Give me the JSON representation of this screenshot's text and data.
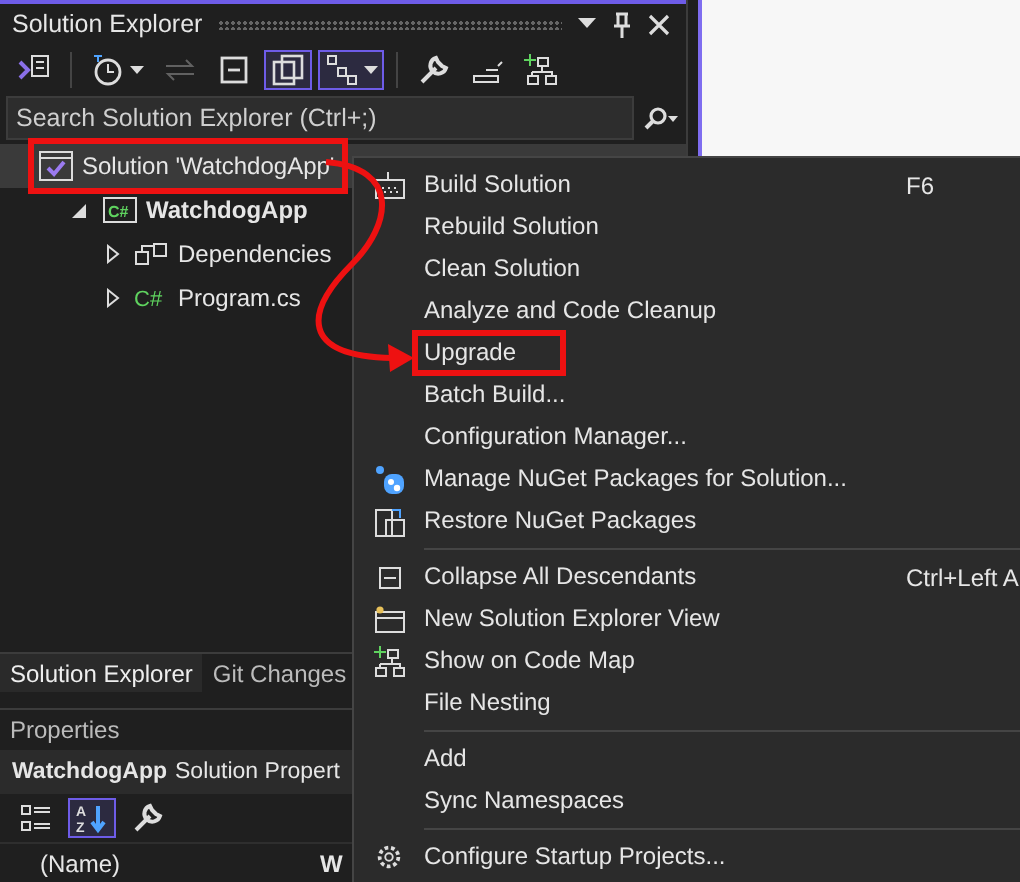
{
  "panel": {
    "title": "Solution Explorer"
  },
  "toolbar": [
    {
      "kind": "home",
      "selected": false,
      "disabled": false
    },
    {
      "kind": "history",
      "selected": false,
      "disabled": false
    },
    {
      "kind": "sync",
      "selected": false,
      "disabled": true
    },
    {
      "kind": "collapse",
      "selected": false,
      "disabled": false
    },
    {
      "kind": "show-all",
      "selected": true,
      "disabled": false
    },
    {
      "kind": "view",
      "selected": true,
      "disabled": false
    },
    {
      "kind": "properties",
      "selected": false,
      "disabled": false
    },
    {
      "kind": "preview",
      "selected": false,
      "disabled": false
    },
    {
      "kind": "code-map",
      "selected": false,
      "disabled": false
    }
  ],
  "search": {
    "placeholder": "Search Solution Explorer (Ctrl+;)"
  },
  "tree": [
    {
      "label": "Solution 'WatchdogApp'",
      "kind": "solution",
      "selected": true,
      "highlighted": true,
      "children": [
        {
          "label": "WatchdogApp",
          "kind": "project",
          "badge": "C#",
          "selected": false,
          "highlighted": false,
          "expanded": true,
          "children": [
            {
              "label": "Dependencies",
              "kind": "dependencies",
              "selected": false,
              "highlighted": false,
              "expanded": false
            },
            {
              "label": "Program.cs",
              "kind": "csharp",
              "badge": "C#",
              "selected": false,
              "highlighted": false,
              "expanded": false
            }
          ]
        }
      ]
    }
  ],
  "bottom_tabs": [
    {
      "label": "Solution Explorer",
      "selected": true
    },
    {
      "label": "Git Changes",
      "selected": false
    }
  ],
  "properties": {
    "title": "Properties",
    "object": "WatchdogApp",
    "object_type": "Solution Propert",
    "toolbar": [
      {
        "kind": "categorized",
        "selected": false
      },
      {
        "kind": "alphabetical",
        "glyphs": [
          "A",
          "Z"
        ],
        "selected": true
      },
      {
        "kind": "property-pages",
        "selected": false
      }
    ],
    "rows": [
      {
        "name": "(Name)",
        "value": "W"
      }
    ]
  },
  "context_menu": [
    {
      "kind": "build",
      "label": "Build Solution",
      "shortcut": "F6",
      "highlighted": false
    },
    {
      "kind": "plain",
      "label": "Rebuild Solution",
      "highlighted": false
    },
    {
      "kind": "plain",
      "label": "Clean Solution",
      "highlighted": false
    },
    {
      "kind": "plain",
      "label": "Analyze and Code Cleanup",
      "highlighted": false
    },
    {
      "kind": "plain",
      "label": "Upgrade",
      "highlighted": true
    },
    {
      "kind": "plain",
      "label": "Batch Build...",
      "highlighted": false
    },
    {
      "kind": "plain",
      "label": "Configuration Manager...",
      "highlighted": false
    },
    {
      "kind": "nuget",
      "label": "Manage NuGet Packages for Solution...",
      "highlighted": false
    },
    {
      "kind": "restore",
      "label": "Restore NuGet Packages",
      "highlighted": false
    },
    {
      "kind": "separator"
    },
    {
      "kind": "collapse",
      "label": "Collapse All Descendants",
      "shortcut": "Ctrl+Left A",
      "highlighted": false
    },
    {
      "kind": "new-view",
      "label": "New Solution Explorer View",
      "highlighted": false
    },
    {
      "kind": "code-map",
      "label": "Show on Code Map",
      "highlighted": false
    },
    {
      "kind": "plain",
      "label": "File Nesting",
      "highlighted": false
    },
    {
      "kind": "separator"
    },
    {
      "kind": "plain",
      "label": "Add",
      "highlighted": false
    },
    {
      "kind": "plain",
      "label": "Sync Namespaces",
      "highlighted": false
    },
    {
      "kind": "separator"
    },
    {
      "kind": "gear",
      "label": "Configure Startup Projects...",
      "highlighted": false
    }
  ]
}
